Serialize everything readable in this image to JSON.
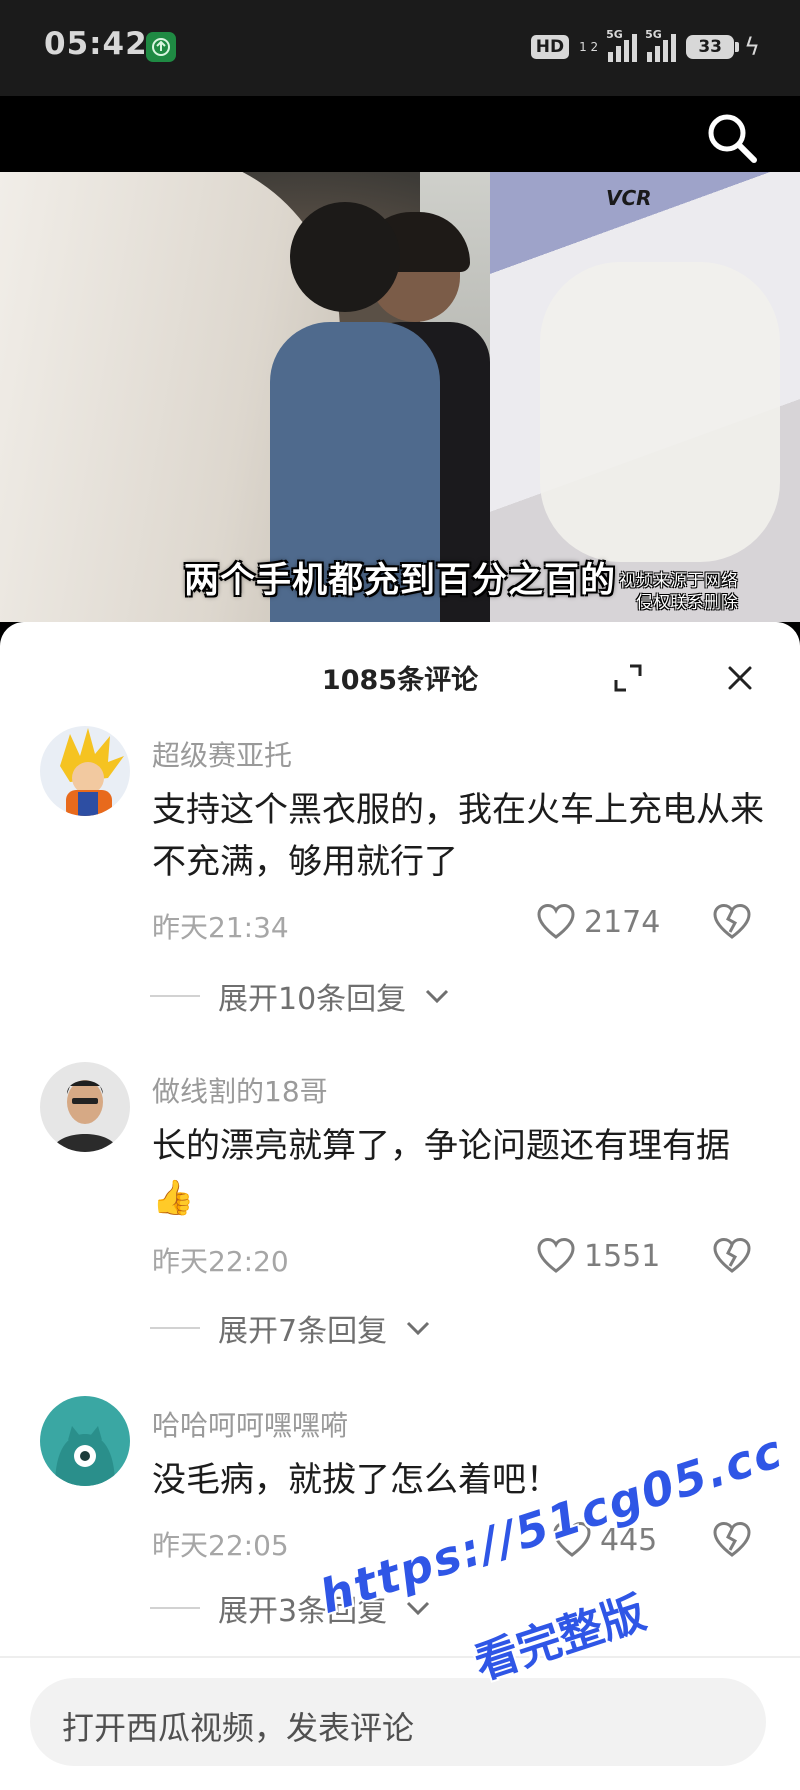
{
  "status_bar": {
    "time": "05:42",
    "hd_label": "HD",
    "hd_sub": "1 2",
    "sig1_label": "5G",
    "sig2_label": "5G",
    "battery": "33"
  },
  "video": {
    "overlay_logo": "VCR",
    "subtitle": "两个手机都充到百分之百的",
    "source_line1": "视频来源于网络",
    "source_line2": "侵权联系删除"
  },
  "comments_panel": {
    "title": "1085条评论",
    "comments": [
      {
        "username": "超级赛亚托",
        "text": "支持这个黑衣服的，我在火车上充电从来不充满，够用就行了",
        "time": "昨天21:34",
        "likes": "2174",
        "replies": "展开10条回复"
      },
      {
        "username": "做线割的18哥",
        "text": "长的漂亮就算了，争论问题还有理有据👍",
        "time": "昨天22:20",
        "likes": "1551",
        "replies": "展开7条回复"
      },
      {
        "username": "哈哈呵呵嘿嘿嗬",
        "text": "没毛病，就拔了怎么着吧！",
        "time": "昨天22:05",
        "likes": "445",
        "replies": "展开3条回复"
      }
    ]
  },
  "comment_input": {
    "placeholder": "打开西瓜视频，发表评论"
  },
  "watermark": {
    "line1": "https://51cg05.cc",
    "line2": "看完整版"
  },
  "colors": {
    "watermark": "#2f56e6",
    "avatar3_bg": "#3aa7a3"
  }
}
